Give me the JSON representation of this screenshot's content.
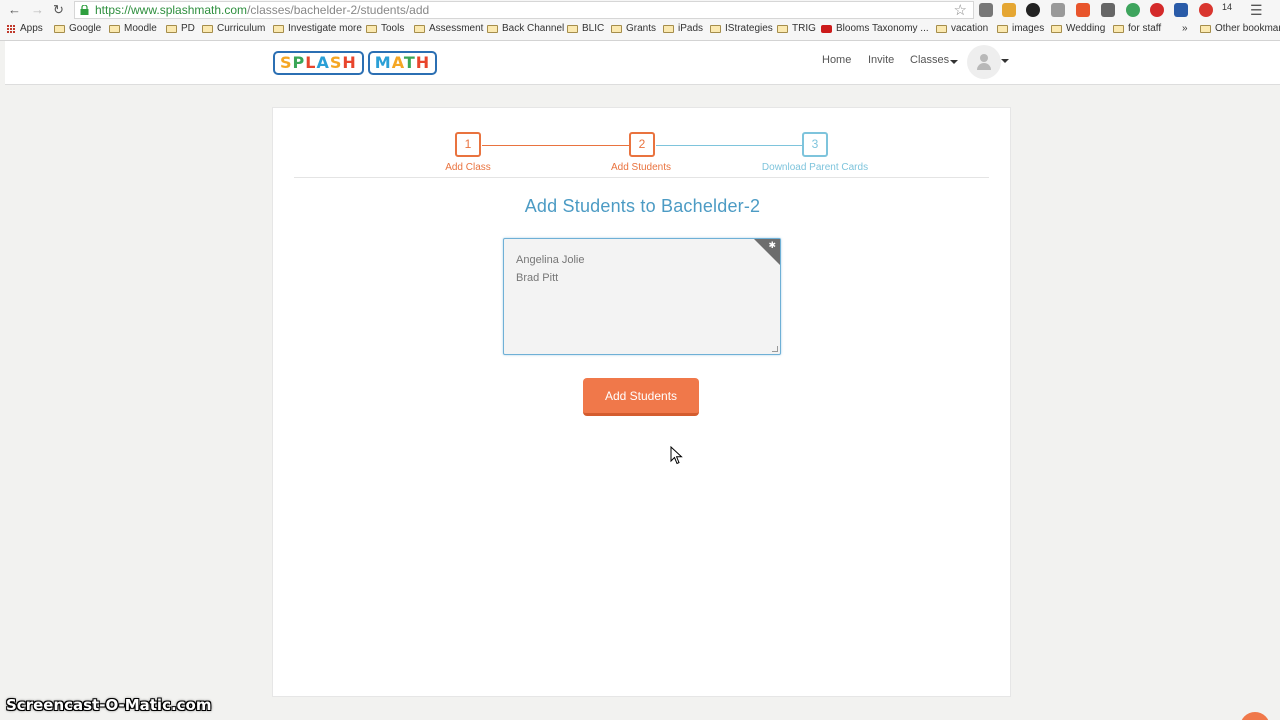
{
  "browser": {
    "url_host": "https://www.splashmath.com",
    "url_path": "/classes/bachelder-2/students/add",
    "badge_count": "14",
    "bookmarks": [
      {
        "label": "Apps",
        "icon": "apps-grid-icon"
      },
      {
        "label": "Google",
        "icon": "folder-icon"
      },
      {
        "label": "Moodle",
        "icon": "folder-icon"
      },
      {
        "label": "PD",
        "icon": "folder-icon"
      },
      {
        "label": "Curriculum",
        "icon": "folder-icon"
      },
      {
        "label": "Investigate more",
        "icon": "folder-icon"
      },
      {
        "label": "Tools",
        "icon": "folder-icon"
      },
      {
        "label": "Assessment",
        "icon": "folder-icon"
      },
      {
        "label": "Back Channel",
        "icon": "folder-icon"
      },
      {
        "label": "BLIC",
        "icon": "folder-icon"
      },
      {
        "label": "Grants",
        "icon": "folder-icon"
      },
      {
        "label": "iPads",
        "icon": "folder-icon"
      },
      {
        "label": "IStrategies",
        "icon": "folder-icon"
      },
      {
        "label": "TRIG",
        "icon": "folder-icon"
      },
      {
        "label": "Blooms Taxonomy ...",
        "icon": "youtube-icon"
      },
      {
        "label": "vacation",
        "icon": "folder-icon"
      },
      {
        "label": "images",
        "icon": "folder-icon"
      },
      {
        "label": "Wedding",
        "icon": "folder-icon"
      },
      {
        "label": "for staff",
        "icon": "folder-icon"
      },
      {
        "label": "»",
        "icon": ""
      },
      {
        "label": "Other bookmarks",
        "icon": "folder-icon"
      }
    ]
  },
  "site": {
    "logo_word_1": [
      "S",
      "P",
      "L",
      "A",
      "S",
      "H"
    ],
    "logo_word_2": [
      "M",
      "A",
      "T",
      "H"
    ],
    "nav": {
      "home": "Home",
      "invite": "Invite",
      "classes": "Classes"
    }
  },
  "wizard": {
    "steps": [
      {
        "number": "1",
        "label": "Add Class",
        "state": "done"
      },
      {
        "number": "2",
        "label": "Add Students",
        "state": "active"
      },
      {
        "number": "3",
        "label": "Download Parent Cards",
        "state": "pending"
      }
    ],
    "colors": {
      "done": "#e9733f",
      "pending": "#7ec4dc"
    }
  },
  "main": {
    "title": "Add Students to Bachelder-2",
    "students_text": "Angelina Jolie\nBrad Pitt",
    "submit_label": "Add Students"
  },
  "watermark": "Screencast-O-Matic.com"
}
